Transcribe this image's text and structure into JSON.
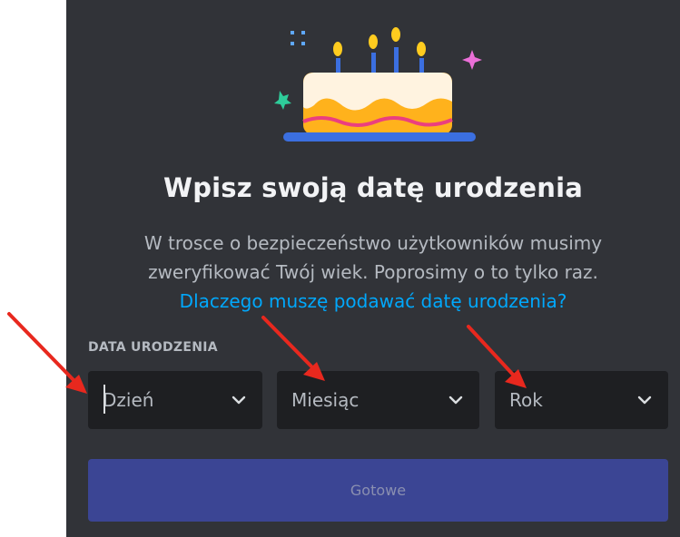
{
  "dialog": {
    "title": "Wpisz swoją datę urodzenia",
    "subtitle_line1": "W trosce o bezpieczeństwo użytkowników musimy",
    "subtitle_line2": "zweryfikować Twój wiek. Poprosimy o to tylko raz.",
    "help_link": "Dlaczego muszę podawać datę urodzenia?"
  },
  "birthdate": {
    "label": "DATA URODZENIA",
    "day_placeholder": "Dzień",
    "month_placeholder": "Miesiąc",
    "year_placeholder": "Rok"
  },
  "submit_label": "Gotowe",
  "colors": {
    "panel_bg": "#313338",
    "input_bg": "#1e1f22",
    "link": "#00a8fc",
    "button_disabled": "#3b4594",
    "annotation_arrow": "#e8281e"
  },
  "icons": [
    "birthday-cake-illustration",
    "chevron-down-icon"
  ]
}
